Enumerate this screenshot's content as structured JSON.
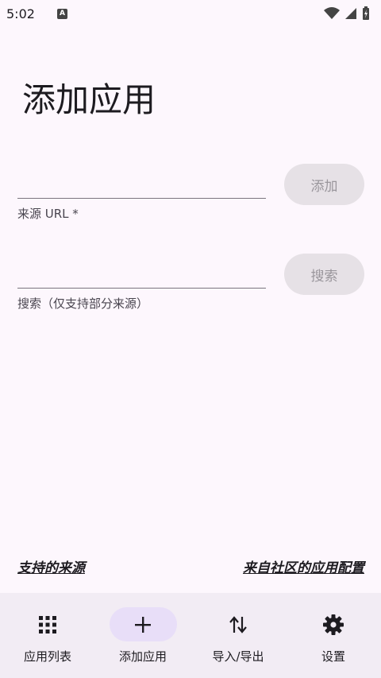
{
  "status": {
    "time": "5:02",
    "notif_letter": "A"
  },
  "page": {
    "title": "添加应用"
  },
  "url_field": {
    "value": "",
    "label": "来源 URL *",
    "button": "添加"
  },
  "search_field": {
    "value": "",
    "label": "搜索（仅支持部分来源）",
    "button": "搜索"
  },
  "links": {
    "supported_sources": "支持的来源",
    "community_configs": "来自社区的应用配置"
  },
  "nav": {
    "items": [
      {
        "label": "应用列表",
        "icon": "grid-icon"
      },
      {
        "label": "添加应用",
        "icon": "plus-icon"
      },
      {
        "label": "导入/导出",
        "icon": "swap-vertical-icon"
      },
      {
        "label": "设置",
        "icon": "gear-icon"
      }
    ],
    "active_index": 1
  },
  "colors": {
    "background": "#fdf7fd",
    "nav_background": "#f2ecf4",
    "active_indicator": "#e8def8",
    "disabled_button": "#e6e1e6"
  }
}
